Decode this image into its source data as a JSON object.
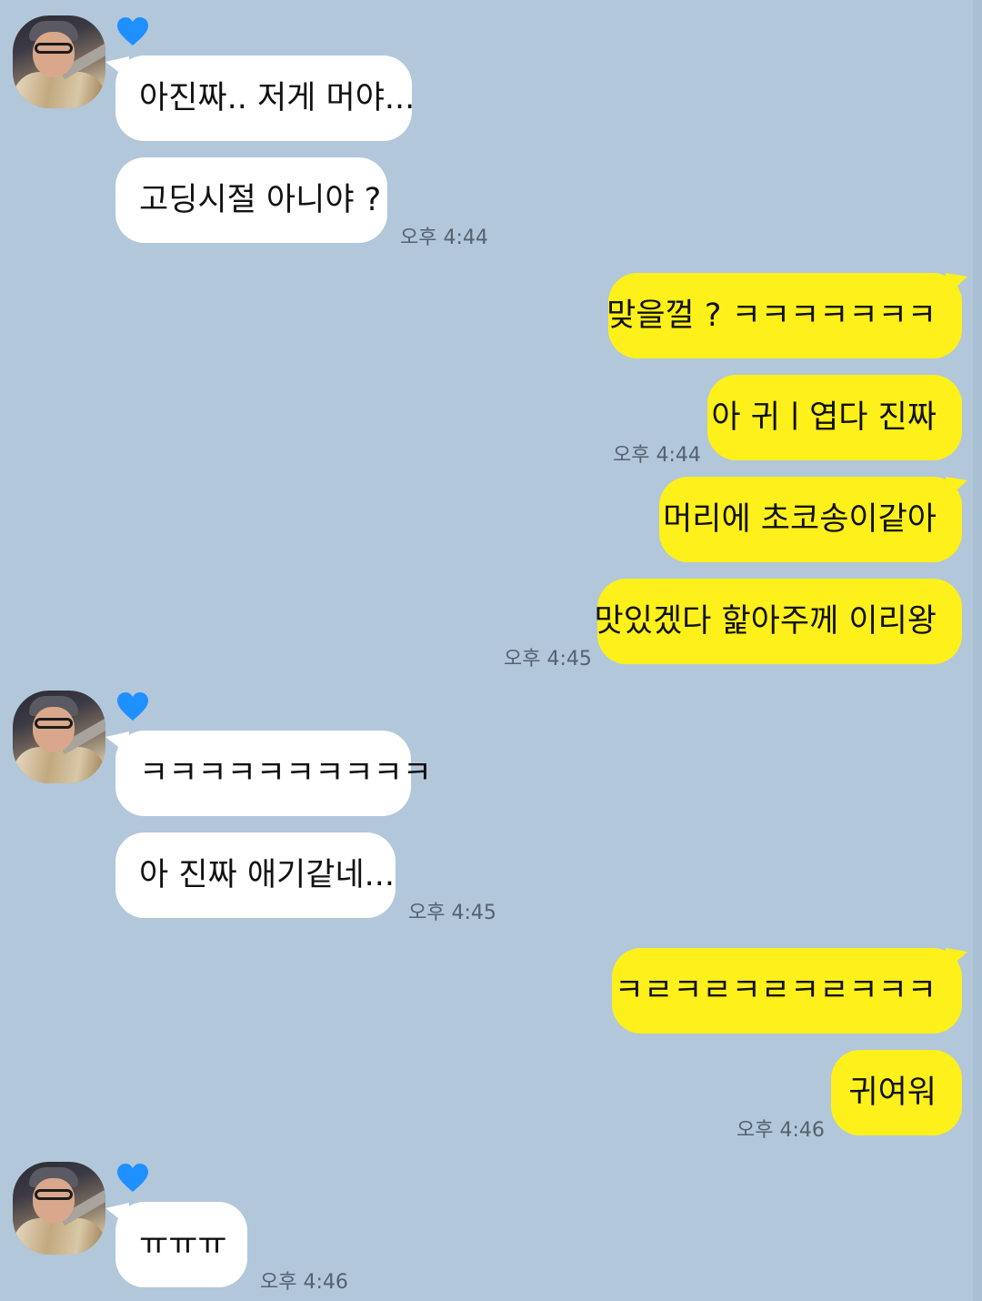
{
  "colors": {
    "background": "#b2c7da",
    "incoming_bubble": "#ffffff",
    "outgoing_bubble": "#fef01b",
    "heart": "#1e90ff"
  },
  "icons": {
    "profile_badge": "blue-heart-icon"
  },
  "groups": [
    {
      "messages": [
        "아진짜.. 저게 머야...",
        "고딩시절 아니야 ?"
      ],
      "time": "오후 4:44"
    },
    {
      "messages": [
        "맞을껄 ? ㅋㅋㅋㅋㅋㅋㅋ",
        "아 귀ㅣ엽다 진짜"
      ],
      "time": "오후 4:44"
    },
    {
      "messages": [
        "머리에 초코송이같아",
        "맛있겠다 핥아주께 이리왕"
      ],
      "time": "오후 4:45"
    },
    {
      "messages": [
        "ㅋㅋㅋㅋㅋㅋㅋㅋㅋㅋ",
        "아 진짜 애기같네..."
      ],
      "time": "오후 4:45"
    },
    {
      "messages": [
        "ㅋㄹㅋㄹㅋㄹㅋㄹㅋㅋㅋ",
        "귀여워"
      ],
      "time": "오후 4:46"
    },
    {
      "messages": [
        "ㅠㅠㅠ"
      ],
      "time": "오후 4:46"
    }
  ]
}
